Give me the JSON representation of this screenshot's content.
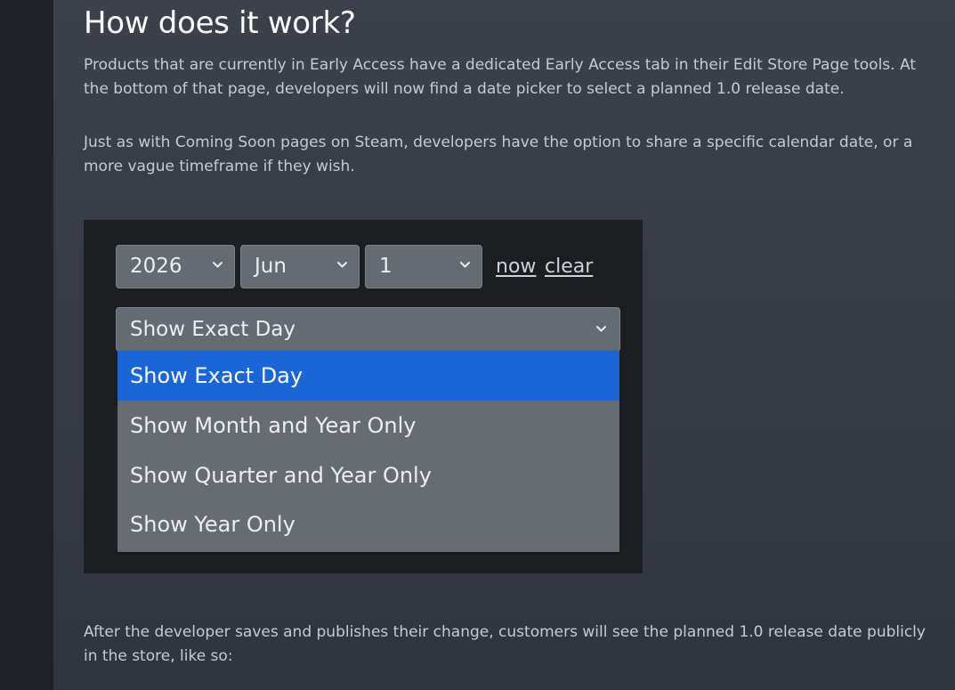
{
  "article": {
    "heading": "How does it work?",
    "paragraph1": "Products that are currently in Early Access have a dedicated Early Access tab in their Edit Store Page tools. At the bottom of that page, developers will now find a date picker to select a planned 1.0 release date.",
    "paragraph2": "Just as with Coming Soon pages on Steam, developers have the option to share a specific calendar date, or a more vague timeframe if they wish.",
    "paragraph3": "After the developer saves and publishes their change, customers will see the planned 1.0 release date publicly in the store, like so:"
  },
  "date_picker": {
    "year": "2026",
    "month": "Jun",
    "day": "1",
    "now_link": "now",
    "clear_link": "clear",
    "display_mode": "Show Exact Day",
    "options": [
      "Show Exact Day",
      "Show Month and Year Only",
      "Show Quarter and Year Only",
      "Show Year Only"
    ],
    "highlighted_option": "Show Exact Day"
  },
  "icons": {
    "select_arrow": "chevron-down-icon"
  },
  "colors": {
    "highlight": "#1a66d8",
    "select_bg": "#656b73",
    "panel_bg": "#1c1e22",
    "link": "#c9d4dc"
  }
}
